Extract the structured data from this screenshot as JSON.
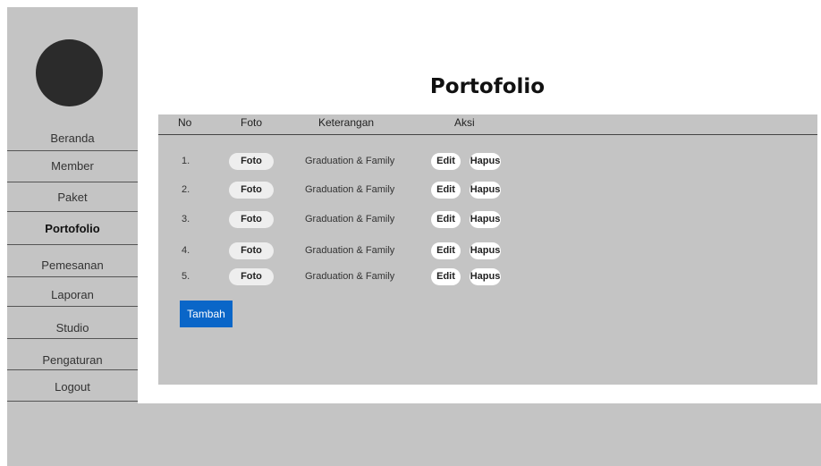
{
  "page": {
    "title": "Portofolio"
  },
  "sidebar": {
    "items": [
      {
        "label": "Beranda",
        "active": false
      },
      {
        "label": "Member",
        "active": false
      },
      {
        "label": "Paket",
        "active": false
      },
      {
        "label": "Portofolio",
        "active": true
      },
      {
        "label": "Pemesanan",
        "active": false
      },
      {
        "label": "Laporan",
        "active": false
      },
      {
        "label": "Studio",
        "active": false
      },
      {
        "label": "Pengaturan",
        "active": false
      },
      {
        "label": "Logout",
        "active": false
      }
    ]
  },
  "table": {
    "headers": {
      "no": "No",
      "foto": "Foto",
      "keterangan": "Keterangan",
      "aksi": "Aksi"
    },
    "rows": [
      {
        "no": "1.",
        "foto": "Foto",
        "keterangan": "Graduation & Family",
        "edit": "Edit",
        "hapus": "Hapus"
      },
      {
        "no": "2.",
        "foto": "Foto",
        "keterangan": "Graduation & Family",
        "edit": "Edit",
        "hapus": "Hapus"
      },
      {
        "no": "3.",
        "foto": "Foto",
        "keterangan": "Graduation & Family",
        "edit": "Edit",
        "hapus": "Hapus"
      },
      {
        "no": "4.",
        "foto": "Foto",
        "keterangan": "Graduation & Family",
        "edit": "Edit",
        "hapus": "Hapus"
      },
      {
        "no": "5.",
        "foto": "Foto",
        "keterangan": "Graduation & Family",
        "edit": "Edit",
        "hapus": "Hapus"
      }
    ]
  },
  "actions": {
    "add_label": "Tambah"
  },
  "colors": {
    "panel": "#c4c4c4",
    "accent": "#0a66c8",
    "avatar": "#2b2b2b"
  }
}
